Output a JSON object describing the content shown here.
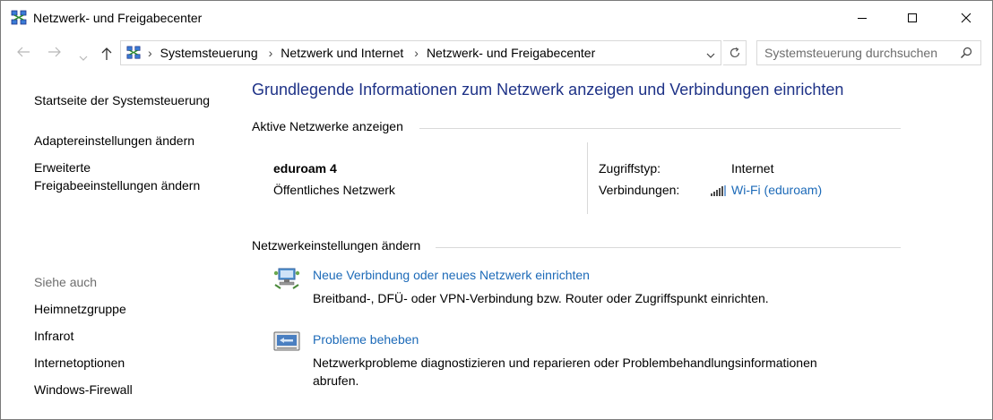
{
  "window": {
    "title": "Netzwerk- und Freigabecenter",
    "controls": [
      "minimize",
      "maximize",
      "close"
    ]
  },
  "address_bar": {
    "breadcrumbs": [
      "Systemsteuerung",
      "Netzwerk und Internet",
      "Netzwerk- und Freigabecenter"
    ],
    "search_placeholder": "Systemsteuerung durchsuchen"
  },
  "sidebar": {
    "links": [
      {
        "label": "Startseite der Systemsteuerung"
      },
      {
        "label": "Adaptereinstellungen ändern"
      },
      {
        "label_line1": "Erweiterte",
        "label_line2": "Freigabeeinstellungen ändern"
      }
    ],
    "see_also_heading": "Siehe auch",
    "see_also": [
      {
        "label": "Heimnetzgruppe"
      },
      {
        "label": "Infrarot"
      },
      {
        "label": "Internetoptionen"
      },
      {
        "label": "Windows-Firewall"
      }
    ]
  },
  "main": {
    "heading": "Grundlegende Informationen zum Netzwerk anzeigen und Verbindungen einrichten",
    "active_networks_heading": "Aktive Netzwerke anzeigen",
    "network": {
      "name": "eduroam  4",
      "type": "Öffentliches Netzwerk",
      "access_type_label": "Zugriffstyp:",
      "access_type_value": "Internet",
      "connections_label": "Verbindungen:",
      "connection_value": "Wi-Fi (eduroam)"
    },
    "change_settings_heading": "Netzwerkeinstellungen ändern",
    "tasks": [
      {
        "icon": "new-connection-icon",
        "title": "Neue Verbindung oder neues Netzwerk einrichten",
        "description": "Breitband-, DFÜ- oder VPN-Verbindung bzw. Router oder Zugriffspunkt einrichten."
      },
      {
        "icon": "troubleshoot-icon",
        "title": "Probleme beheben",
        "description_line1": "Netzwerkprobleme diagnostizieren und reparieren oder Problembehandlungsinformationen",
        "description_line2": "abrufen."
      }
    ]
  },
  "colors": {
    "heading": "#1e3287",
    "link": "#1c6ab8",
    "muted": "#6d6d6d",
    "separator": "#d9d9d9"
  }
}
